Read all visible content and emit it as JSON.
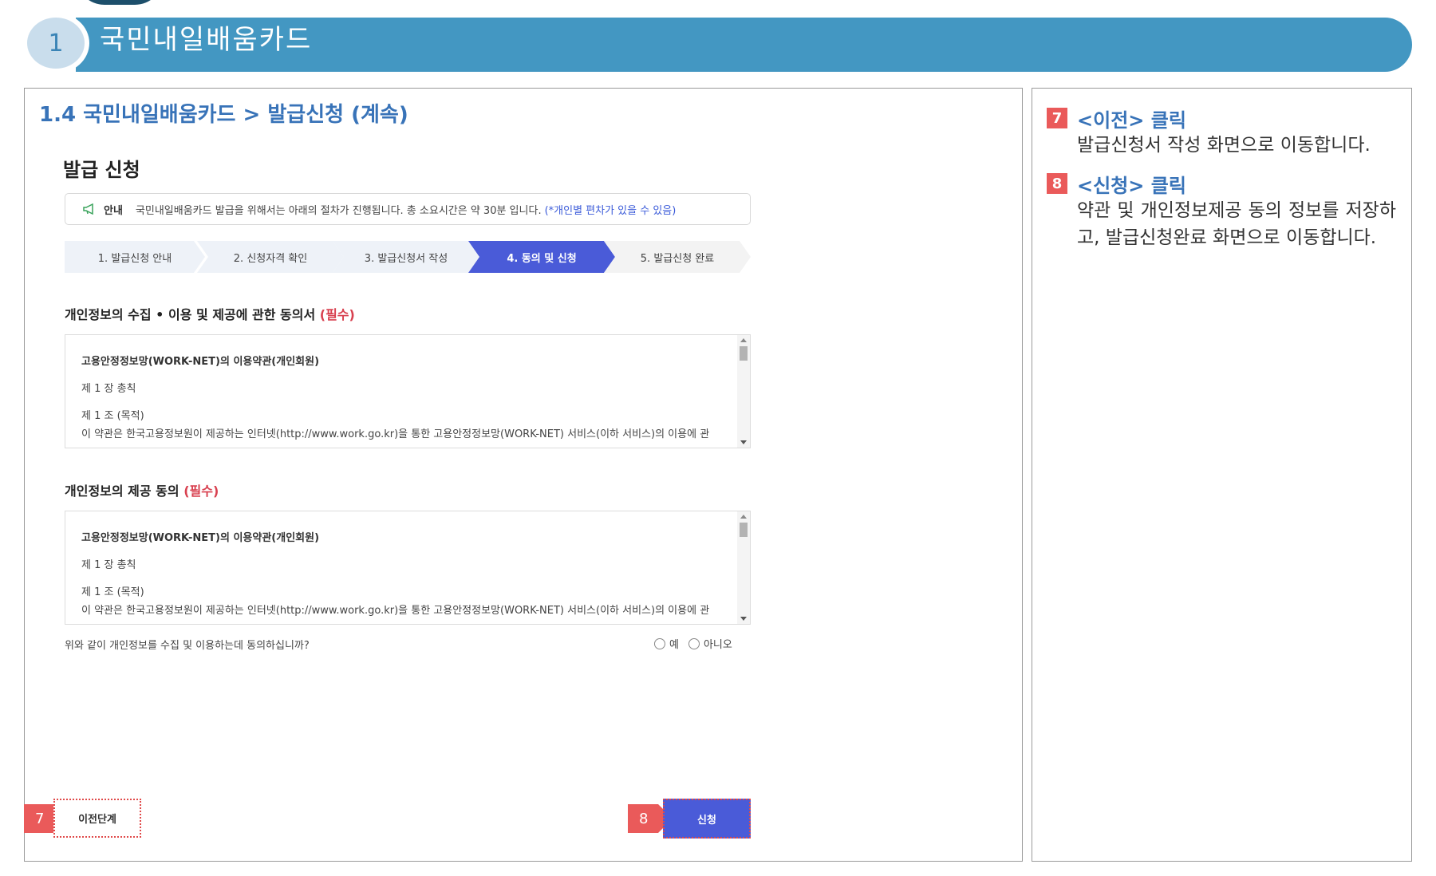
{
  "chapter": {
    "number": "1",
    "title": "국민내일배움카드"
  },
  "section": {
    "heading": "1.4 국민내일배움카드 > 발급신청 (계속)"
  },
  "form": {
    "page_title": "발급 신청",
    "notice": {
      "label": "안내",
      "text": "국민내일배움카드 발급을 위해서는 아래의 절차가 진행됩니다. 총 소요시간은 약 30분 입니다.",
      "extra": "(*개인별 편차가 있을 수 있음)"
    },
    "steps": [
      {
        "label": "1. 발급신청 안내",
        "state": "done"
      },
      {
        "label": "2. 신청자격 확인",
        "state": "done"
      },
      {
        "label": "3. 발급신청서 작성",
        "state": "done"
      },
      {
        "label": "4. 동의 및 신청",
        "state": "active"
      },
      {
        "label": "5. 발급신청 완료",
        "state": "pending"
      }
    ],
    "agreement1": {
      "heading": "개인정보의 수집 • 이용 및 제공에 관한 동의서",
      "required": "(필수)",
      "terms": {
        "title": "고용안정정보망(WORK-NET)의 이용약관(개인회원)",
        "chapter": "제 1 장 총칙",
        "article": "제 1 조 (목적)",
        "body": "이 약관은 한국고용정보원이 제공하는 인터넷(http://www.work.go.kr)을 통한 고용안정정보망(WORK-NET) 서비스(이하 서비스)의 이용에 관"
      }
    },
    "agreement2": {
      "heading": "개인정보의 제공 동의",
      "required": "(필수)",
      "terms": {
        "title": "고용안정정보망(WORK-NET)의 이용약관(개인회원)",
        "chapter": "제 1 장 총칙",
        "article": "제 1 조 (목적)",
        "body": "이 약관은 한국고용정보원이 제공하는 인터넷(http://www.work.go.kr)을 통한 고용안정정보망(WORK-NET) 서비스(이하 서비스)의 이용에 관"
      }
    },
    "consent": {
      "question": "위와 같이 개인정보를 수집 및 이용하는데 동의하십니까?",
      "options": [
        "예",
        "아니오"
      ]
    },
    "buttons": {
      "prev": "이전단계",
      "submit": "신청"
    },
    "callouts": {
      "prev": "7",
      "submit": "8"
    }
  },
  "notes": [
    {
      "badge": "7",
      "title": "<이전> 클릭",
      "body": "발급신청서 작성 화면으로 이동합니다."
    },
    {
      "badge": "8",
      "title": "<신청> 클릭",
      "body": "약관 및 개인정보제공 동의 정보를 저장하고, 발급신청완료 화면으로 이동합니다."
    }
  ],
  "colors": {
    "banner": "#4397c2",
    "heading": "#3873b8",
    "active_step": "#4a5bd8",
    "required": "#d8404f",
    "callout": "#ea5a5a"
  }
}
